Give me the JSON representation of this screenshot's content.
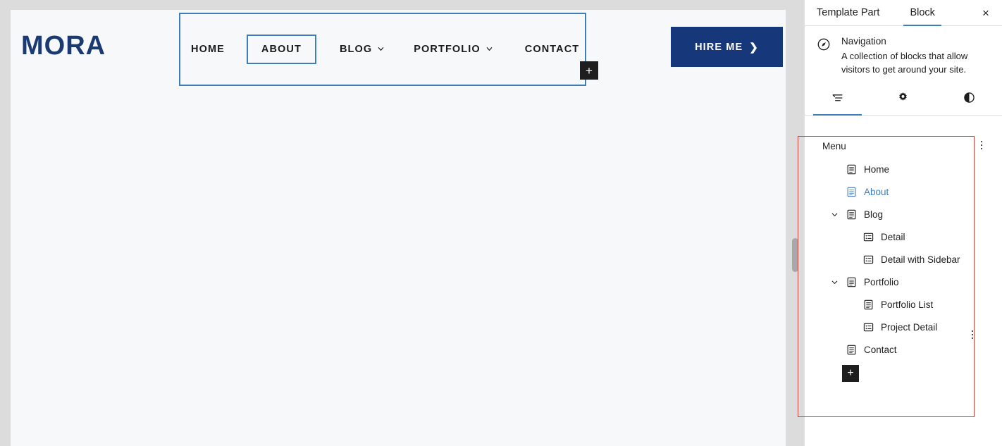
{
  "site": {
    "logo": "MORA",
    "nav": [
      {
        "label": "HOME",
        "has_submenu": false,
        "selected": false
      },
      {
        "label": "ABOUT",
        "has_submenu": false,
        "selected": true
      },
      {
        "label": "BLOG",
        "has_submenu": true,
        "selected": false
      },
      {
        "label": "PORTFOLIO",
        "has_submenu": true,
        "selected": false
      },
      {
        "label": "CONTACT",
        "has_submenu": false,
        "selected": false
      }
    ],
    "cta": {
      "label": "HIRE ME",
      "arrow": "❯",
      "bg": "#16387a",
      "color": "#ffffff"
    },
    "logo_color": "#1b3a72",
    "appender_label": "+",
    "selection_outline_color": "#3e7fbb",
    "canvas_bg": "#f7f8fa"
  },
  "sidebar": {
    "tabs": [
      {
        "label": "Template Part",
        "active": false
      },
      {
        "label": "Block",
        "active": true
      }
    ],
    "close_label": "×",
    "block": {
      "icon": "navigation-compass-icon",
      "name": "Navigation",
      "description": "A collection of blocks that allow visitors to get around your site."
    },
    "icon_tabs": [
      {
        "name": "list-view-icon",
        "active": true
      },
      {
        "name": "gear-icon",
        "active": false
      },
      {
        "name": "styles-contrast-icon",
        "active": false
      }
    ],
    "list_view": {
      "header_label": "Menu",
      "options_label": "⋮",
      "add_label": "+",
      "selection_color": "#c9433f",
      "items": [
        {
          "label": "Home",
          "level": 1,
          "icon": "page-icon",
          "expandable": false,
          "selected": false
        },
        {
          "label": "About",
          "level": 1,
          "icon": "page-icon",
          "expandable": false,
          "selected": true
        },
        {
          "label": "Blog",
          "level": 1,
          "icon": "page-icon",
          "expandable": true,
          "expanded": true,
          "selected": false
        },
        {
          "label": "Detail",
          "level": 2,
          "icon": "list-item-icon",
          "expandable": false,
          "selected": false
        },
        {
          "label": "Detail with Sidebar",
          "level": 2,
          "icon": "list-item-icon",
          "expandable": false,
          "selected": false
        },
        {
          "label": "Portfolio",
          "level": 1,
          "icon": "page-icon",
          "expandable": true,
          "expanded": true,
          "selected": false
        },
        {
          "label": "Portfolio List",
          "level": 2,
          "icon": "page-icon",
          "expandable": false,
          "selected": false
        },
        {
          "label": "Project Detail",
          "level": 2,
          "icon": "list-item-icon",
          "expandable": false,
          "selected": false
        },
        {
          "label": "Contact",
          "level": 1,
          "icon": "page-icon",
          "expandable": false,
          "selected": false
        }
      ]
    }
  }
}
